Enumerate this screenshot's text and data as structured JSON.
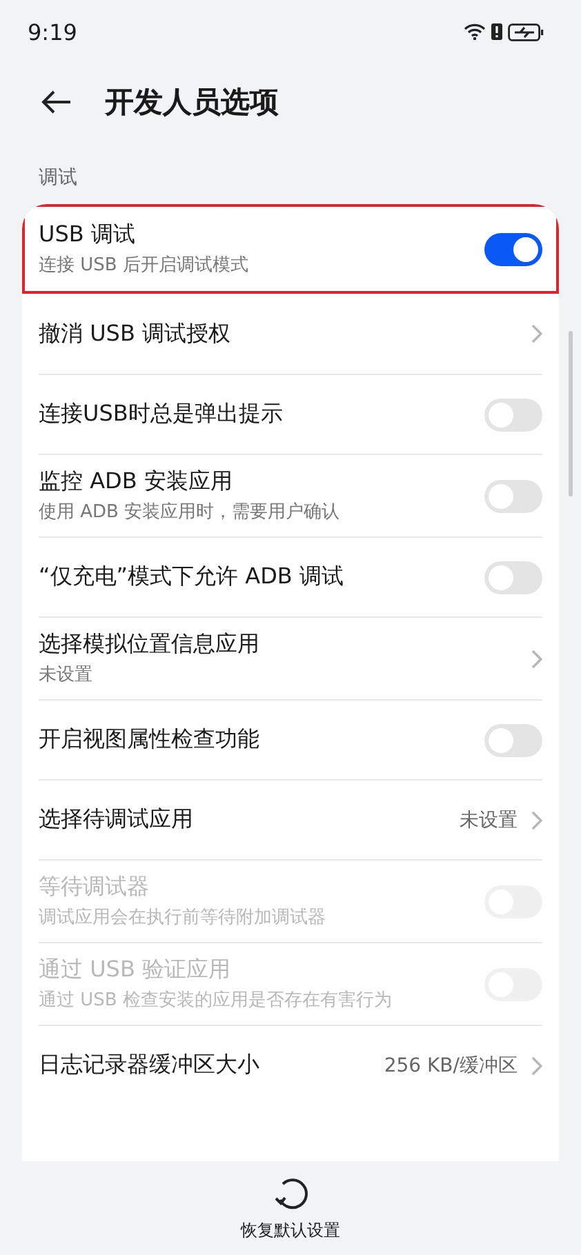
{
  "status_bar": {
    "time": "9:19"
  },
  "header": {
    "title": "开发人员选项"
  },
  "section": {
    "label": "调试"
  },
  "items": [
    {
      "kind": "toggle",
      "title": "USB 调试",
      "subtitle": "连接 USB 后开启调试模式",
      "on": true,
      "disabled": false,
      "highlighted": true
    },
    {
      "kind": "link",
      "title": "撤消 USB 调试授权",
      "disabled": false,
      "highlighted": false
    },
    {
      "kind": "toggle",
      "title": "连接USB时总是弹出提示",
      "on": false,
      "disabled": false,
      "highlighted": false
    },
    {
      "kind": "toggle",
      "title": "监控 ADB 安装应用",
      "subtitle": "使用 ADB 安装应用时，需要用户确认",
      "on": false,
      "disabled": false,
      "highlighted": false
    },
    {
      "kind": "toggle",
      "title": "“仅充电”模式下允许 ADB 调试",
      "on": false,
      "disabled": false,
      "highlighted": false
    },
    {
      "kind": "link",
      "title": "选择模拟位置信息应用",
      "subtitle": "未设置",
      "disabled": false,
      "highlighted": false
    },
    {
      "kind": "toggle",
      "title": "开启视图属性检查功能",
      "on": false,
      "disabled": false,
      "highlighted": false
    },
    {
      "kind": "link",
      "title": "选择待调试应用",
      "value": "未设置",
      "disabled": false,
      "highlighted": false
    },
    {
      "kind": "toggle",
      "title": "等待调试器",
      "subtitle": "调试应用会在执行前等待附加调试器",
      "on": false,
      "disabled": true,
      "highlighted": false
    },
    {
      "kind": "toggle",
      "title": "通过 USB 验证应用",
      "subtitle": "通过 USB 检查安装的应用是否存在有害行为",
      "on": false,
      "disabled": true,
      "highlighted": false
    },
    {
      "kind": "link",
      "title": "日志记录器缓冲区大小",
      "value": "256 KB/缓冲区",
      "disabled": false,
      "highlighted": false
    }
  ],
  "bottom_action": {
    "label": "恢复默认设置"
  }
}
